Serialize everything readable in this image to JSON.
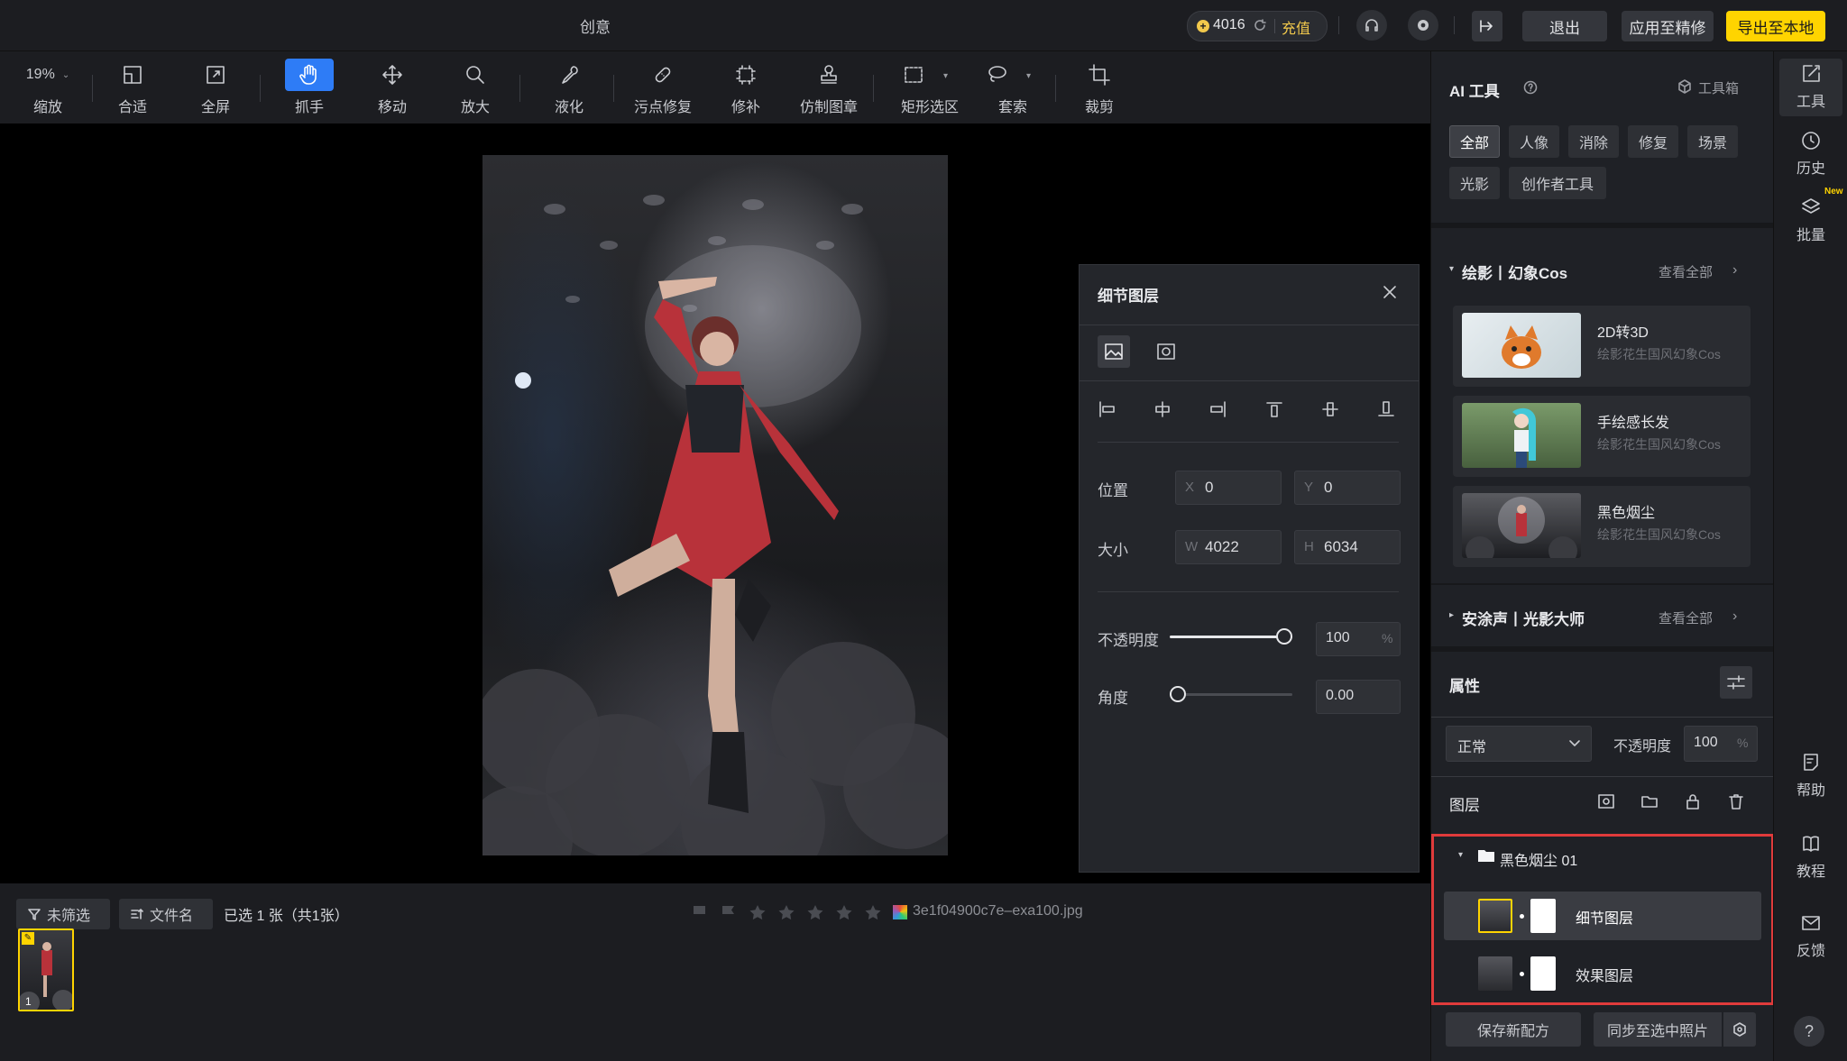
{
  "title_bar": {
    "app_title": "创意",
    "credits": "4016",
    "recharge_label": "充值",
    "exit_label": "退出",
    "apply_label": "应用至精修",
    "export_label": "导出至本地",
    "export_color": "#ffd400"
  },
  "toolbar": {
    "zoom_value": "19%",
    "zoom_label": "缩放",
    "fit_label": "合适",
    "fullscreen_label": "全屏",
    "hand_label": "抓手",
    "move_label": "移动",
    "magnify_label": "放大",
    "liquify_label": "液化",
    "spot_label": "污点修复",
    "patch_label": "修补",
    "stamp_label": "仿制图章",
    "rect_label": "矩形选区",
    "lasso_label": "套索",
    "crop_label": "裁剪",
    "active_color": "#2e7cf6"
  },
  "detail_panel": {
    "title": "细节图层",
    "position_label": "位置",
    "x_prefix": "X",
    "x_value": "0",
    "y_prefix": "Y",
    "y_value": "0",
    "size_label": "大小",
    "w_prefix": "W",
    "w_value": "4022",
    "h_prefix": "H",
    "h_value": "6034",
    "opacity_label": "不透明度",
    "opacity_value": "100",
    "opacity_unit": "%",
    "opacity_level": 1.0,
    "angle_label": "角度",
    "angle_value": "0.00",
    "angle_level": 0.0
  },
  "filmstrip": {
    "filter_label": "未筛选",
    "sort_label": "文件名",
    "selection_text": "已选 1 张（共1张）",
    "filename": "3e1f04900c7e–exa100.jpg",
    "thumb_index": "1"
  },
  "right_panel": {
    "ai_title": "AI 工具",
    "toolbox_label": "工具箱",
    "chips": [
      "全部",
      "人像",
      "消除",
      "修复",
      "场景",
      "光影",
      "创作者工具"
    ],
    "section1_title": "绘影丨幻象Cos",
    "see_all": "查看全部",
    "cards": [
      {
        "title": "2D转3D",
        "sub": "绘影花生国风幻象Cos"
      },
      {
        "title": "手绘感长发",
        "sub": "绘影花生国风幻象Cos"
      },
      {
        "title": "黑色烟尘",
        "sub": "绘影花生国风幻象Cos"
      }
    ],
    "section2_title": "安涂声丨光影大师",
    "attr_title": "属性",
    "blend_mode": "正常",
    "opacity_label": "不透明度",
    "opacity_value": "100",
    "opacity_unit": "%",
    "layers_title": "图层",
    "group_name": "黑色烟尘 01",
    "layers": [
      "细节图层",
      "效果图层"
    ],
    "save_recipe": "保存新配方",
    "sync_label": "同步至选中照片",
    "highlight_color": "#e03b3b"
  },
  "rail": {
    "tools": "工具",
    "history": "历史",
    "batch": "批量",
    "new_badge": "New",
    "help": "帮助",
    "tutorial": "教程",
    "feedback": "反馈",
    "question": "?"
  }
}
